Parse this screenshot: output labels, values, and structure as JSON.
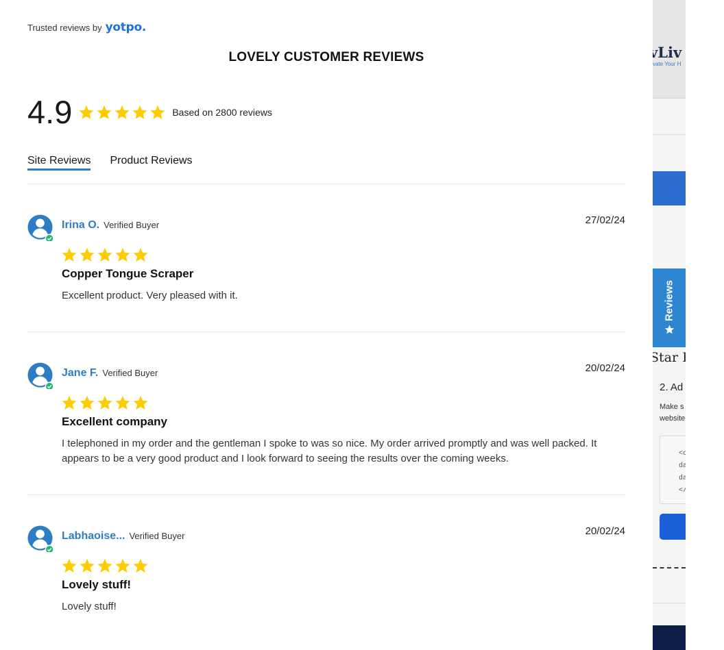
{
  "header": {
    "trusted_text": "Trusted reviews by",
    "brand": "yotpo.",
    "title": "LOVELY CUSTOMER REVIEWS"
  },
  "summary": {
    "average_rating": "4.9",
    "stars_filled": 5,
    "based_on": "Based on 2800 reviews"
  },
  "tabs": [
    {
      "label": "Site Reviews",
      "active": true
    },
    {
      "label": "Product Reviews",
      "active": false
    }
  ],
  "reviews": [
    {
      "name": "Irina O.",
      "badge": "Verified Buyer",
      "date": "27/02/24",
      "rating": 5,
      "title": "Copper Tongue Scraper",
      "body": "Excellent product. Very pleased with it."
    },
    {
      "name": "Jane F.",
      "badge": "Verified Buyer",
      "date": "20/02/24",
      "rating": 5,
      "title": "Excellent company",
      "body": "I telephoned in my order and the gentleman I spoke to was so nice. My order arrived promptly and was well packed. It appears to be a very good product and I look forward to seeing the results over the coming weeks."
    },
    {
      "name": "Labhaoise...",
      "badge": "Verified Buyer",
      "date": "20/02/24",
      "rating": 5,
      "title": "Lovely stuff!",
      "body": "Lovely stuff!"
    }
  ],
  "background_page": {
    "logo_fragment": "vLiv",
    "logo_sub_fragment": "vate Your H",
    "floating_tab_label": "Reviews",
    "heading_fragment": "Star R",
    "step_fragment": "2. Ad",
    "text_fragments": [
      "Make s",
      "website"
    ],
    "code_fragments": [
      "<c",
      "da",
      "da",
      "</"
    ]
  },
  "colors": {
    "accent_blue": "#2e7dc4",
    "star_yellow": "#ffcc00",
    "verified_green": "#22b573",
    "brand_blue": "#1d73d8"
  }
}
